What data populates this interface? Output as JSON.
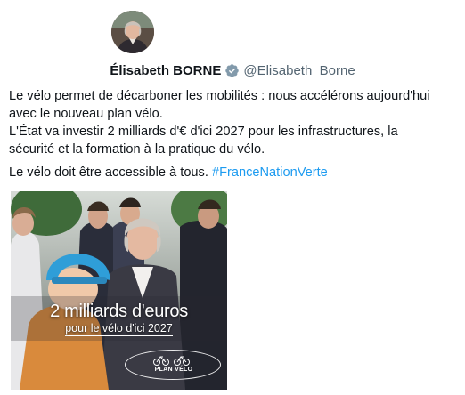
{
  "tweet": {
    "author": {
      "display_name": "Élisabeth BORNE",
      "handle": "@Elisabeth_Borne",
      "verified_icon": "verified-badge-icon"
    },
    "text_lines": [
      "Le vélo permet de décarboner les mobilités : nous accélérons aujourd'hui",
      "avec le nouveau plan vélo.",
      "L'État va investir 2 milliards d'€ d'ici 2027 pour les infrastructures, la",
      "sécurité et la formation à la pratique du vélo."
    ],
    "closing_text": "Le vélo doit être accessible à tous. ",
    "hashtag": "#FranceNationVerte",
    "media": {
      "headline": "2 milliards d'euros",
      "subline": "pour le vélo d'ici 2027",
      "logo_text": "PLAN VÉLO"
    }
  },
  "colors": {
    "link": "#1d9bf0",
    "verified": "#829aab",
    "text": "#0f1419",
    "secondary": "#536471"
  }
}
